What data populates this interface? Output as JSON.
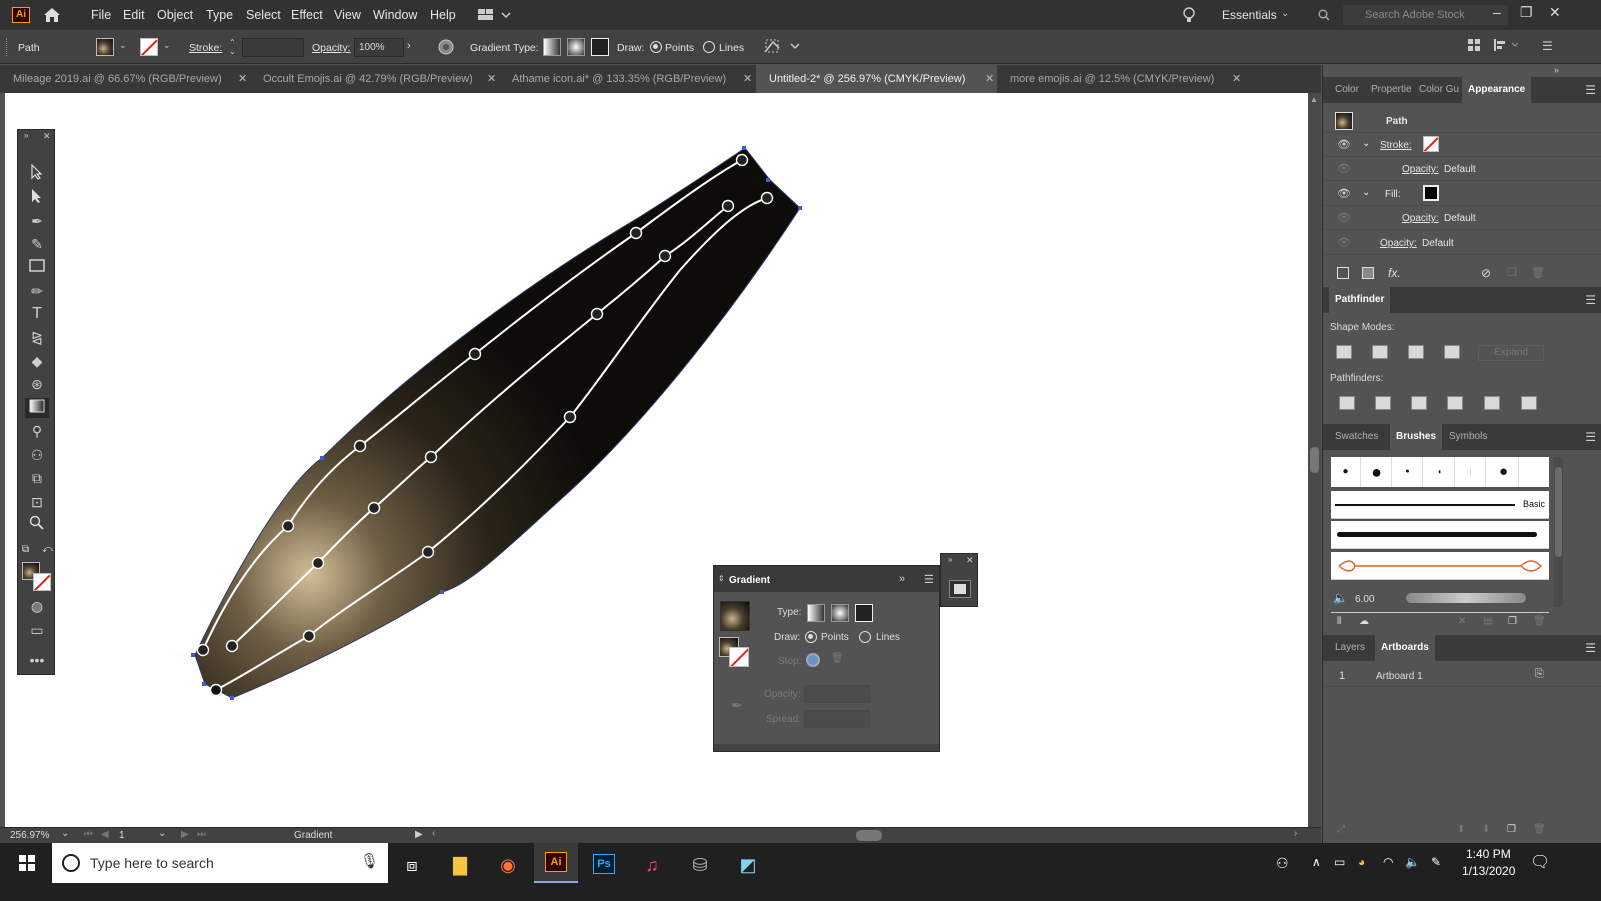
{
  "menubar": {
    "app_logo": "Ai",
    "items": [
      "File",
      "Edit",
      "Object",
      "Type",
      "Select",
      "Effect",
      "View",
      "Window",
      "Help"
    ],
    "workspace": "Essentials",
    "search_placeholder": "Search Adobe Stock"
  },
  "controlbar": {
    "selection_type": "Path",
    "stroke_label": "Stroke:",
    "opacity_label": "Opacity:",
    "opacity_value": "100%",
    "gradient_type_label": "Gradient Type:",
    "draw_label": "Draw:",
    "points_label": "Points",
    "lines_label": "Lines"
  },
  "tabs": [
    {
      "label": "Mileage 2019.ai @ 66.67% (RGB/Preview)"
    },
    {
      "label": "Occult Emojis.ai @ 42.79% (RGB/Preview)"
    },
    {
      "label": "Athame icon.ai* @ 133.35% (RGB/Preview)"
    },
    {
      "label": "Untitled-2* @ 256.97% (CMYK/Preview)"
    },
    {
      "label": "more emojis.ai @ 12.5% (CMYK/Preview)"
    }
  ],
  "statusbar": {
    "zoom": "256.97%",
    "artboard_number": "1",
    "current_tool": "Gradient"
  },
  "appearance": {
    "tabs": [
      "Color",
      "Propertie",
      "Color Gu",
      "Appearance"
    ],
    "title": "Path",
    "stroke_label": "Stroke:",
    "fill_label": "Fill:",
    "opacity_label": "Opacity:",
    "opacity_value": "Default",
    "fx_label": "fx."
  },
  "pathfinder": {
    "tab": "Pathfinder",
    "shape_modes_label": "Shape Modes:",
    "pathfinders_label": "Pathfinders:",
    "expand_label": "Expand"
  },
  "brushes": {
    "tabs": [
      "Swatches",
      "Brushes",
      "Symbols"
    ],
    "basic_label": "Basic",
    "size_value": "6.00"
  },
  "layers": {
    "tabs": [
      "Layers",
      "Artboards"
    ],
    "artboard_index": "1",
    "artboard_name": "Artboard 1"
  },
  "gradient_panel": {
    "title": "Gradient",
    "type_label": "Type:",
    "draw_label": "Draw:",
    "points_label": "Points",
    "lines_label": "Lines",
    "stop_label": "Stop:",
    "opacity_label": "Opacity:",
    "spread_label": "Spread:"
  },
  "taskbar": {
    "search_placeholder": "Type here to search",
    "time": "1:40 PM",
    "date": "1/13/2020"
  },
  "colors": {
    "accent_stroke": "#e0241b",
    "gradient_light": "#c9b48c",
    "gradient_dark": "#0a0a0a",
    "ai_orange": "#ff9a00"
  }
}
